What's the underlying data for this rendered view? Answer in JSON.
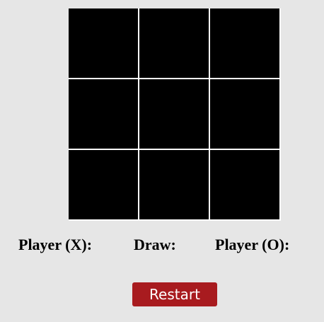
{
  "board": {
    "cells": [
      "",
      "",
      "",
      "",
      "",
      "",
      "",
      "",
      ""
    ]
  },
  "scoreboard": {
    "player_x_label": "Player (X):",
    "player_x_value": "",
    "draw_label": "Draw:",
    "draw_value": "",
    "player_o_label": "Player (O):",
    "player_o_value": ""
  },
  "controls": {
    "restart_label": "Restart"
  },
  "colors": {
    "background": "#e6e6e6",
    "cell": "#000000",
    "grid_lines": "#ffffff",
    "restart_button": "#a81b1f"
  }
}
